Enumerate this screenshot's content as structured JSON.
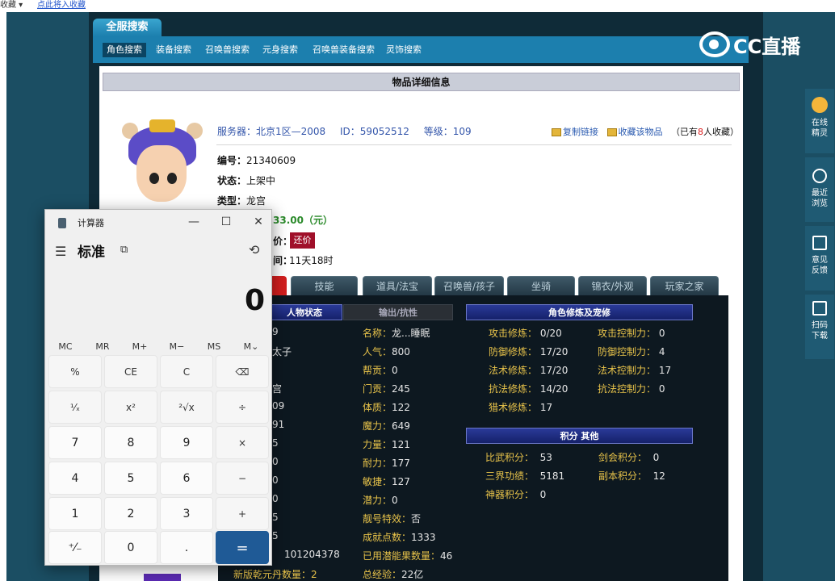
{
  "browser": {
    "favorites_menu": "收藏 ▾",
    "add_favorite": "点此将入收藏"
  },
  "site": {
    "tab_header": "全服搜索",
    "nav": [
      "角色搜索",
      "装备搜索",
      "召唤兽搜索",
      "元身搜索",
      "召唤兽装备搜索",
      "灵饰搜索"
    ],
    "logo": "CC直播"
  },
  "detail": {
    "header": "物品详细信息",
    "server": "服务器：北京1区—2008",
    "id": "ID：59052512",
    "level": "等级：109",
    "copy_link": "复制链接",
    "favorite": "收藏该物品",
    "fav_count_pre": "（已有",
    "fav_count": "8",
    "fav_count_post": "人收藏）",
    "number_label": "编号：",
    "number": "21340609",
    "status_label": "状态：",
    "status": "上架中",
    "type_label": "类型：",
    "type": "龙宫",
    "price": "33.00（元）",
    "bargain_suffix": "价：",
    "bargain_button": "还价",
    "time_suffix": "间：",
    "time_left": "11天18时"
  },
  "tabs": [
    "",
    "技能",
    "道具/法宝",
    "召唤兽/孩子",
    "坐骑",
    "锦衣/外观",
    "玩家之家"
  ],
  "panel": {
    "sub_left_1": "人物状态",
    "sub_left_2": "输出/抗性",
    "sub_cultivation": "角色修炼及宠修",
    "sub_points": "积分 其他",
    "left_col": [
      "9",
      "太子",
      "",
      "宫",
      "09",
      "91",
      "5",
      "0",
      "0",
      "0",
      "5",
      "5",
      "101204378",
      "新版乾元丹数量：2"
    ],
    "mid_col": [
      {
        "k": "名称：",
        "v": "龙...睡眠"
      },
      {
        "k": "人气：",
        "v": "800"
      },
      {
        "k": "帮贡：",
        "v": "0"
      },
      {
        "k": "门贡：",
        "v": "245"
      },
      {
        "k": "体质：",
        "v": "122"
      },
      {
        "k": "魔力：",
        "v": "649"
      },
      {
        "k": "力量：",
        "v": "121"
      },
      {
        "k": "耐力：",
        "v": "177"
      },
      {
        "k": "敏捷：",
        "v": "127"
      },
      {
        "k": "潜力：",
        "v": "0"
      },
      {
        "k": "靓号特效：",
        "v": "否"
      },
      {
        "k": "成就点数：",
        "v": "1333"
      },
      {
        "k": "已用潜能果数量：",
        "v": "46"
      },
      {
        "k": "总经验：",
        "v": "22亿"
      }
    ],
    "cultivation": [
      {
        "k": "攻击修炼：",
        "v": "0/20",
        "k2": "攻击控制力：",
        "v2": "0"
      },
      {
        "k": "防御修炼：",
        "v": "17/20",
        "k2": "防御控制力：",
        "v2": "4"
      },
      {
        "k": "法术修炼：",
        "v": "17/20",
        "k2": "法术控制力：",
        "v2": "17"
      },
      {
        "k": "抗法修炼：",
        "v": "14/20",
        "k2": "抗法控制力：",
        "v2": "0"
      },
      {
        "k": "猎术修炼：",
        "v": "17",
        "k2": "",
        "v2": ""
      }
    ],
    "points": [
      {
        "k": "比武积分：",
        "v": "53",
        "k2": "剑会积分：",
        "v2": "0"
      },
      {
        "k": "三界功绩：",
        "v": "5181",
        "k2": "副本积分：",
        "v2": "12"
      },
      {
        "k": "神器积分：",
        "v": "0",
        "k2": "",
        "v2": ""
      }
    ]
  },
  "calculator": {
    "title": "计算器",
    "mode": "标准",
    "display": "0",
    "memory": [
      "MC",
      "MR",
      "M+",
      "M−",
      "MS",
      "M⌄"
    ],
    "keys": [
      "%",
      "CE",
      "C",
      "⌫",
      "¹⁄ₓ",
      "x²",
      "²√x",
      "÷",
      "7",
      "8",
      "9",
      "×",
      "4",
      "5",
      "6",
      "−",
      "1",
      "2",
      "3",
      "+",
      "⁺⁄₋",
      "0",
      ".",
      "="
    ]
  },
  "sidebar": {
    "online": "在线\n精灵",
    "recent": "最近\n浏览",
    "feedback": "意见\n反馈",
    "scan": "扫码\n下载"
  },
  "colors": {
    "accent": "#1c7fae",
    "dark_bg": "#0f2b38",
    "calc_equals": "#1f5a96",
    "bargain": "#a0102a",
    "label_gold": "#e8c34a"
  }
}
